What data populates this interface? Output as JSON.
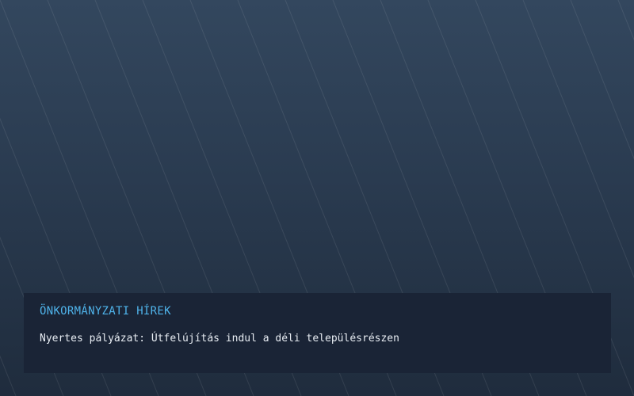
{
  "news": {
    "heading": "ÖNKORMÁNYZATI HÍREK",
    "headline": "Nyertes pályázat: Útfelújítás indul a déli településrészen"
  },
  "colors": {
    "background_top": "#33475e",
    "background_bottom": "#1f2c3d",
    "panel_background": "#1a2436",
    "heading_accent": "#4fb3ea",
    "text": "#e8edf3"
  }
}
